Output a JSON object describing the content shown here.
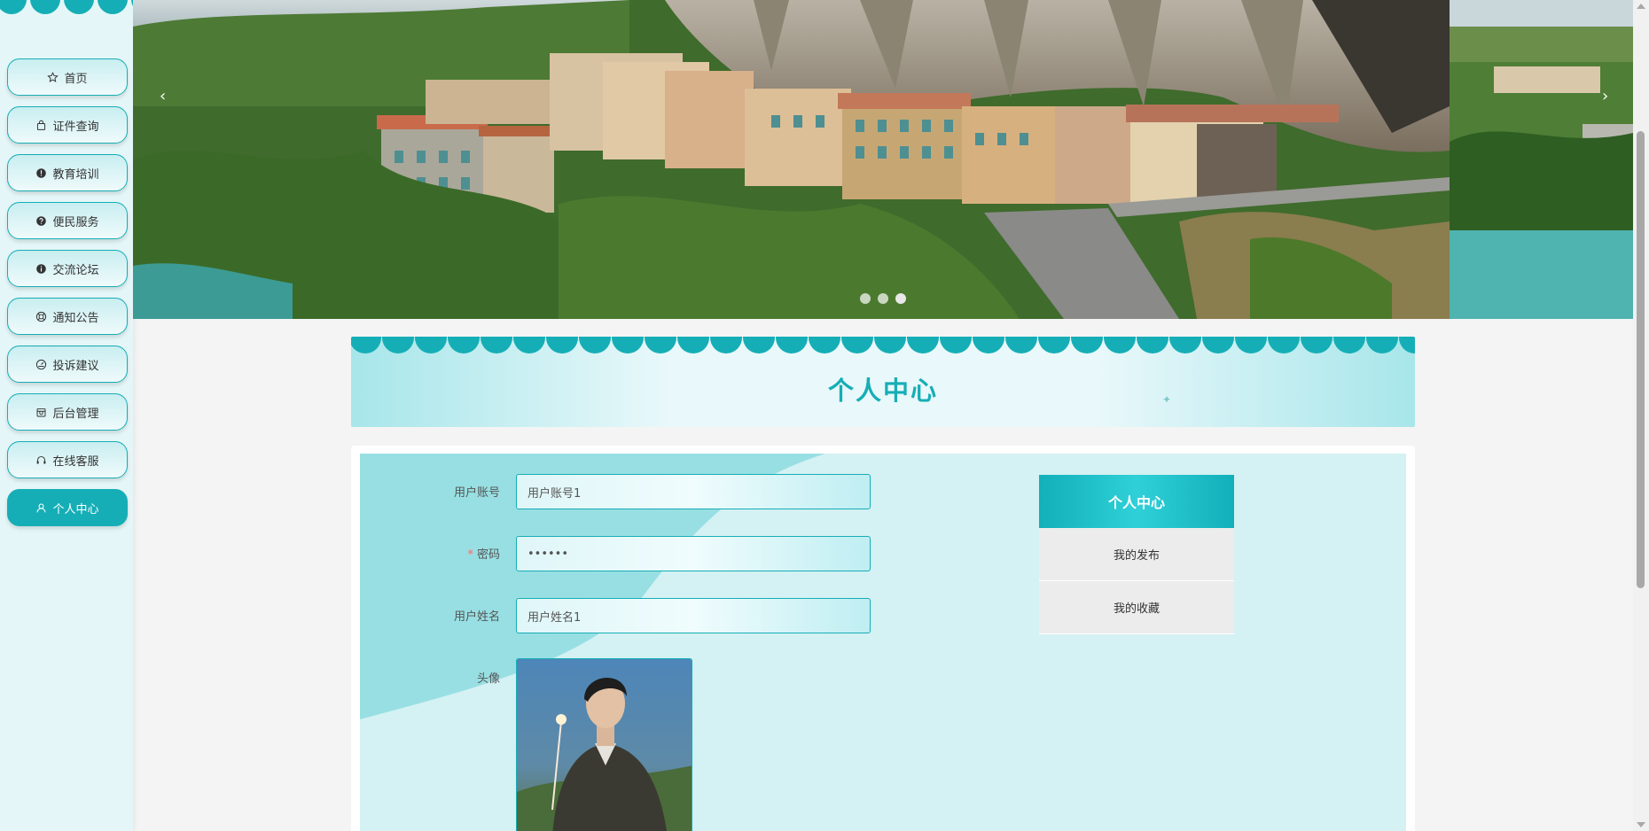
{
  "sidebar": {
    "items": [
      {
        "label": "首页",
        "icon": "star-icon"
      },
      {
        "label": "证件查询",
        "icon": "bag-icon"
      },
      {
        "label": "教育培训",
        "icon": "warning-circle-icon"
      },
      {
        "label": "便民服务",
        "icon": "question-circle-icon"
      },
      {
        "label": "交流论坛",
        "icon": "info-circle-icon"
      },
      {
        "label": "通知公告",
        "icon": "lifebuoy-icon"
      },
      {
        "label": "投诉建议",
        "icon": "dashboard-icon"
      },
      {
        "label": "后台管理",
        "icon": "shop-icon"
      },
      {
        "label": "在线客服",
        "icon": "headset-icon"
      },
      {
        "label": "个人中心",
        "icon": "user-icon",
        "active": true
      }
    ]
  },
  "carousel": {
    "slide_count": 3,
    "active_index": 2
  },
  "page_title": "个人中心",
  "form": {
    "account": {
      "label": "用户账号",
      "value": "用户账号1"
    },
    "password": {
      "label": "密码",
      "required_mark": "*",
      "value": "••••••"
    },
    "name": {
      "label": "用户姓名",
      "value": "用户姓名1"
    },
    "avatar": {
      "label": "头像"
    }
  },
  "side_menu": {
    "title": "个人中心",
    "items": [
      "我的发布",
      "我的收藏"
    ]
  },
  "colors": {
    "accent": "#16aeb6",
    "panel": "#d4f1f3"
  }
}
